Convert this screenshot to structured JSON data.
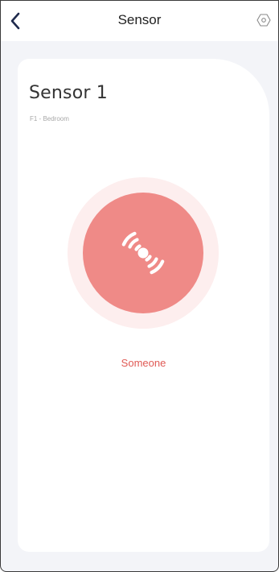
{
  "header": {
    "title": "Sensor",
    "back_icon": "chevron-left-icon",
    "settings_icon": "hexagon-settings-icon"
  },
  "device": {
    "name": "Sensor 1",
    "location": "F1 - Bedroom"
  },
  "status": {
    "label": "Someone",
    "icon": "motion-waves-icon",
    "color": "#ef8a87",
    "label_color": "#e05a55"
  },
  "colors": {
    "background": "#f3f4f8",
    "card": "#ffffff",
    "accent_ring": "#fdeeee",
    "nav_icon": "#1f2a4d"
  }
}
